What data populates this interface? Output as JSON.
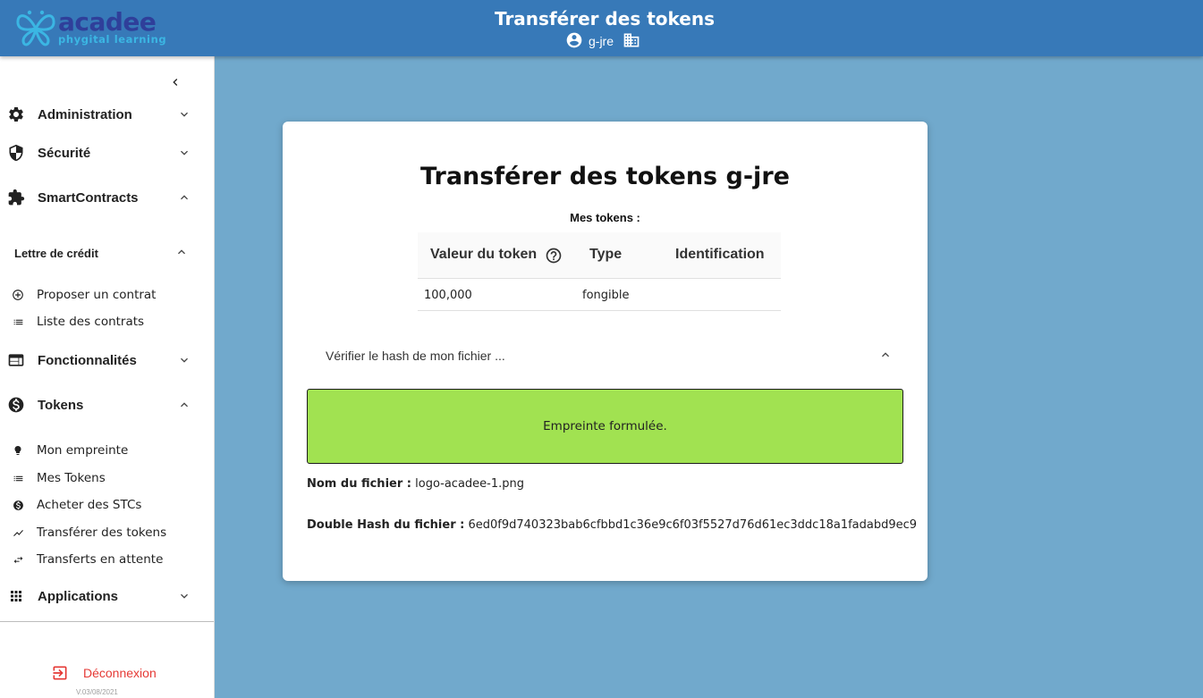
{
  "header": {
    "logo_main": "acadee",
    "logo_sub": "phygital learning",
    "title": "Transférer des tokens",
    "user_name": "g-jre"
  },
  "colors": {
    "header_bg": "#3779b8",
    "page_bg": "#71a9cc",
    "success_bg": "#a1e251",
    "logout": "#e53935"
  },
  "sidebar": {
    "collapse_icon": "chevron-left-icon",
    "sections": [
      {
        "label": "Administration",
        "icon": "gear-icon",
        "expanded": false
      },
      {
        "label": "Sécurité",
        "icon": "shield-icon",
        "expanded": false
      },
      {
        "label": "SmartContracts",
        "icon": "puzzle-icon",
        "expanded": true
      },
      {
        "label": "Fonctionnalités",
        "icon": "browser-window-icon",
        "expanded": false
      },
      {
        "label": "Tokens",
        "icon": "dollar-circle-icon",
        "expanded": true
      },
      {
        "label": "Applications",
        "icon": "apps-grid-icon",
        "expanded": false
      }
    ],
    "lettre": {
      "label": "Lettre de crédit",
      "items": [
        {
          "label": "Proposer un contrat",
          "icon": "add-circle-icon"
        },
        {
          "label": "Liste des contrats",
          "icon": "list-icon"
        }
      ]
    },
    "tokens_items": [
      {
        "label": "Mon empreinte",
        "icon": "bulb-icon"
      },
      {
        "label": "Mes Tokens",
        "icon": "list-icon"
      },
      {
        "label": "Acheter des STCs",
        "icon": "dollar-circle-icon"
      },
      {
        "label": "Transférer des tokens",
        "icon": "trending-icon"
      },
      {
        "label": "Transferts en attente",
        "icon": "swap-icon"
      }
    ],
    "logout_label": "Déconnexion",
    "version": "V.03/08/2021"
  },
  "main": {
    "title": "Transférer des tokens g-jre",
    "tokens_label": "Mes tokens :",
    "table": {
      "headers": [
        "Valeur du token",
        "Type",
        "Identification"
      ],
      "rows": [
        [
          "100,000",
          "fongible",
          ""
        ]
      ]
    },
    "verify_label": "Vérifier le hash de mon fichier ...",
    "success_message": "Empreinte formulée.",
    "file_name_label": "Nom du fichier :",
    "file_name": "logo-acadee-1.png",
    "double_hash_label": "Double Hash du fichier :",
    "double_hash": "6ed0f9d740323bab6cfbbd1c36e9c6f03f5527d76d61ec3ddc18a1fadabd9ec9"
  }
}
